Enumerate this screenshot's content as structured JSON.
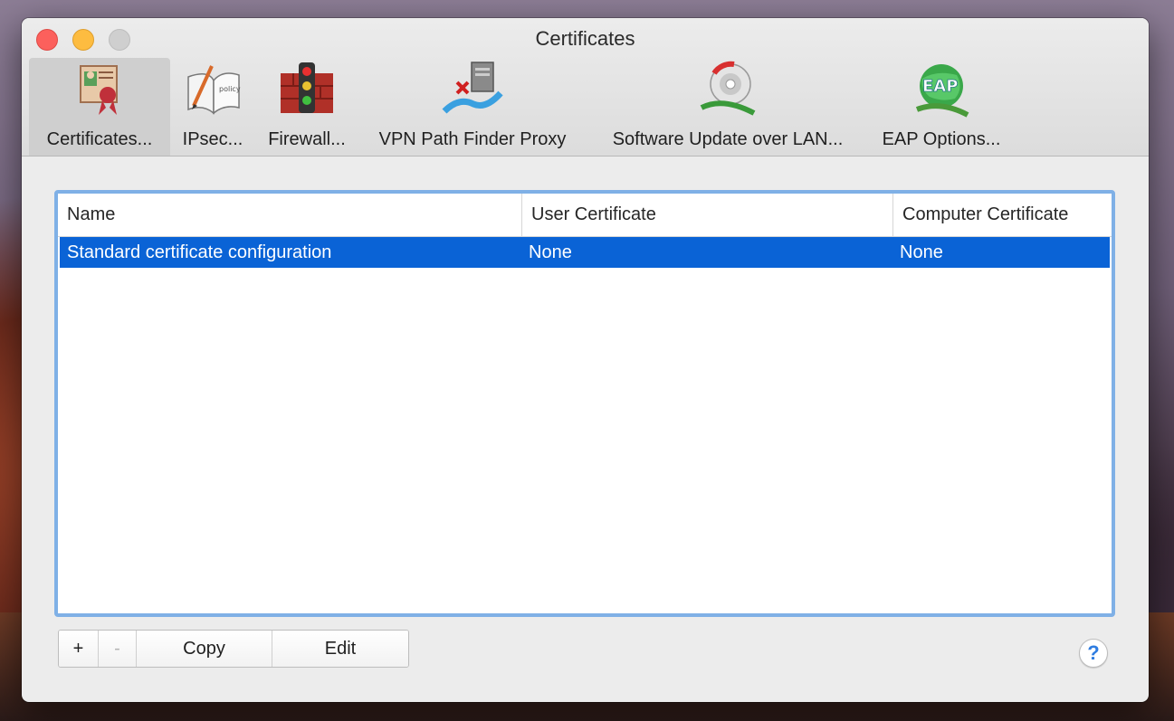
{
  "window": {
    "title": "Certificates"
  },
  "toolbar": {
    "items": [
      {
        "label": "Certificates...",
        "icon": "certificate-icon",
        "selected": true
      },
      {
        "label": "IPsec...",
        "icon": "policy-pen-icon",
        "selected": false
      },
      {
        "label": "Firewall...",
        "icon": "firewall-traffic-light-icon",
        "selected": false
      },
      {
        "label": "VPN Path Finder Proxy",
        "icon": "vpn-path-finder-icon",
        "selected": false
      },
      {
        "label": "Software Update over LAN...",
        "icon": "software-update-disc-icon",
        "selected": false
      },
      {
        "label": "EAP Options...",
        "icon": "eap-globe-icon",
        "selected": false
      }
    ]
  },
  "table": {
    "columns": [
      "Name",
      "User Certificate",
      "Computer Certificate"
    ],
    "rows": [
      {
        "name": "Standard certificate configuration",
        "user_certificate": "None",
        "computer_certificate": "None",
        "selected": true
      }
    ]
  },
  "buttons": {
    "add": "+",
    "remove": "-",
    "copy": "Copy",
    "edit": "Edit",
    "help": "?"
  },
  "colors": {
    "selection": "#0a63d6",
    "focus_ring": "#7fb0e6",
    "close": "#fc605c",
    "minimize": "#fdbc40"
  }
}
